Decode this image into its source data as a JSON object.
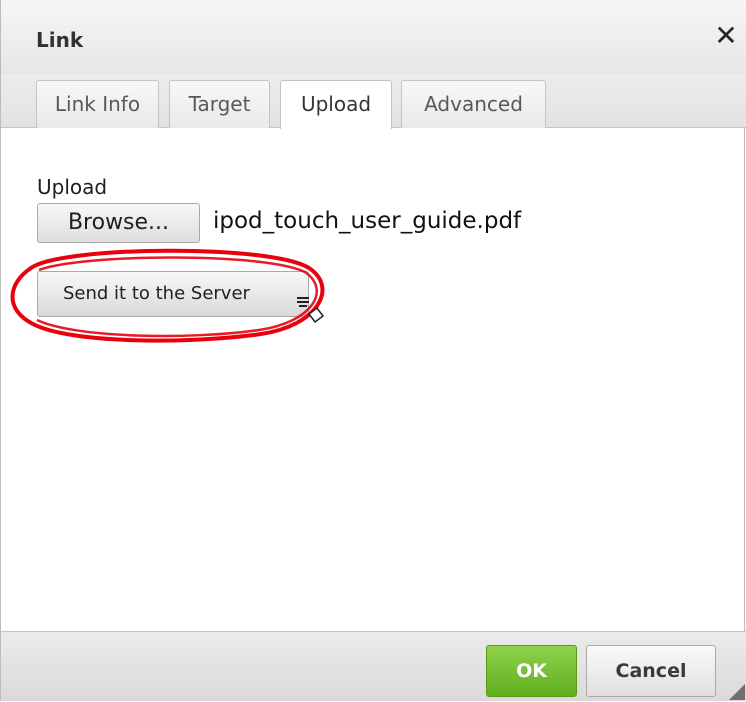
{
  "dialog": {
    "title": "Link",
    "close_icon": "close-x-icon"
  },
  "tabs": [
    {
      "label": "Link Info",
      "active": false
    },
    {
      "label": "Target",
      "active": false
    },
    {
      "label": "Upload",
      "active": true
    },
    {
      "label": "Advanced",
      "active": false
    }
  ],
  "upload": {
    "label": "Upload",
    "browse_label": "Browse...",
    "filename": "ipod_touch_user_guide.pdf",
    "send_label": "Send it to the Server"
  },
  "footer": {
    "ok_label": "OK",
    "cancel_label": "Cancel"
  },
  "colors": {
    "ok_green": "#6cbf2a",
    "annotation_red": "#e8000d"
  },
  "icons": {
    "cursor": "cursor-pointer-icon",
    "resize": "resize-grip-icon",
    "annotation": "red-ellipse-annotation"
  }
}
